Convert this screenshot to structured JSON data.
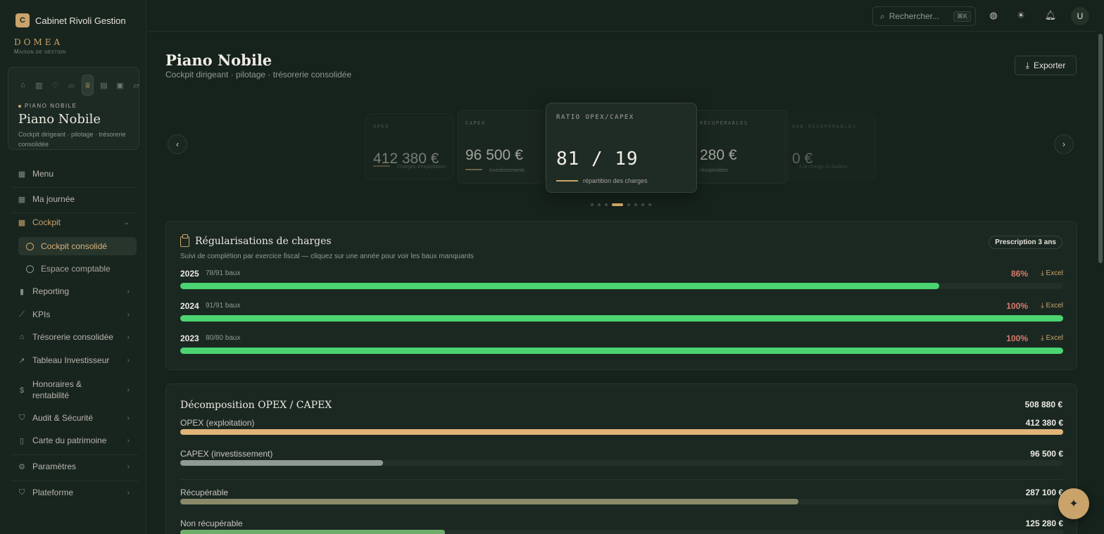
{
  "org": {
    "badge": "C",
    "name": "Cabinet Rivoli Gestion"
  },
  "brand": {
    "name": "DOMEA",
    "sub": "Maison de gestion"
  },
  "module_card": {
    "icons": [
      "home-icon",
      "building-icon",
      "handshake-icon",
      "bell-service-icon",
      "crown-icon",
      "document-icon",
      "contact-icon",
      "folder-icon"
    ],
    "kicker": "PIANO NOBILE",
    "title": "Piano Nobile",
    "desc": "Cockpit dirigeant · pilotage · trésorerie consolidée"
  },
  "nav": {
    "menu": "Menu",
    "ma_journee": "Ma journée",
    "cockpit": "Cockpit",
    "cockpit_consolide": "Cockpit consolidé",
    "espace_comptable": "Espace comptable",
    "reporting": "Reporting",
    "kpis": "KPIs",
    "tresorerie": "Trésorerie consolidée",
    "tableau_investisseur": "Tableau Investisseur",
    "honoraires": "Honoraires & rentabilité",
    "audit": "Audit & Sécurité",
    "carte": "Carte du patrimoine",
    "parametres": "Paramètres",
    "plateforme": "Plateforme"
  },
  "topbar": {
    "search_placeholder": "Rechercher...",
    "kbd": "⌘K",
    "avatar": "U"
  },
  "page": {
    "title": "Piano Nobile",
    "subtitle": "Cockpit dirigeant · pilotage · trésorerie consolidée",
    "export": "Exporter"
  },
  "kpis": [
    {
      "label": "OPEX",
      "value": "412 380 €",
      "caption": "Charges d'exploitation"
    },
    {
      "label": "CAPEX",
      "value": "96 500 €",
      "caption": "Investissements"
    },
    {
      "label": "RATIO OPEX/CAPEX",
      "value": "81 / 19",
      "caption": "répartition des charges"
    },
    {
      "label": "RÉCUPÉRABLES",
      "value": "280 €",
      "caption": "récupérables"
    },
    {
      "label": "NON RÉCUPÉRABLES",
      "value": "0 €",
      "caption": "à la charge du bailleur"
    }
  ],
  "carousel": {
    "dots": 8,
    "active": 3
  },
  "regularisations": {
    "title": "Régularisations de charges",
    "badge": "Prescription 3 ans",
    "subtitle": "Suivi de complétion par exercice fiscal — cliquez sur une année pour voir les baux manquants",
    "excel_label": "Excel",
    "rows": [
      {
        "year": "2025",
        "baux": "78/91 baux",
        "pct": "86%",
        "ratio": 0.86
      },
      {
        "year": "2024",
        "baux": "91/91 baux",
        "pct": "100%",
        "ratio": 1.0
      },
      {
        "year": "2023",
        "baux": "80/80 baux",
        "pct": "100%",
        "ratio": 1.0
      }
    ]
  },
  "decomposition": {
    "title": "Décomposition OPEX / CAPEX",
    "total": "508 880 €",
    "rows": [
      {
        "label": "OPEX (exploitation)",
        "value": "412 380 €",
        "ratio": 1.0,
        "color": "#e0b478"
      },
      {
        "label": "CAPEX (investissement)",
        "value": "96 500 €",
        "ratio": 0.23,
        "color": "#8e9a93"
      },
      {
        "label": "Récupérable",
        "value": "287 100 €",
        "ratio": 0.7,
        "color": "#8a8a6a"
      },
      {
        "label": "Non récupérable",
        "value": "125 280 €",
        "ratio": 0.3,
        "color": "#6fae6a"
      }
    ]
  }
}
